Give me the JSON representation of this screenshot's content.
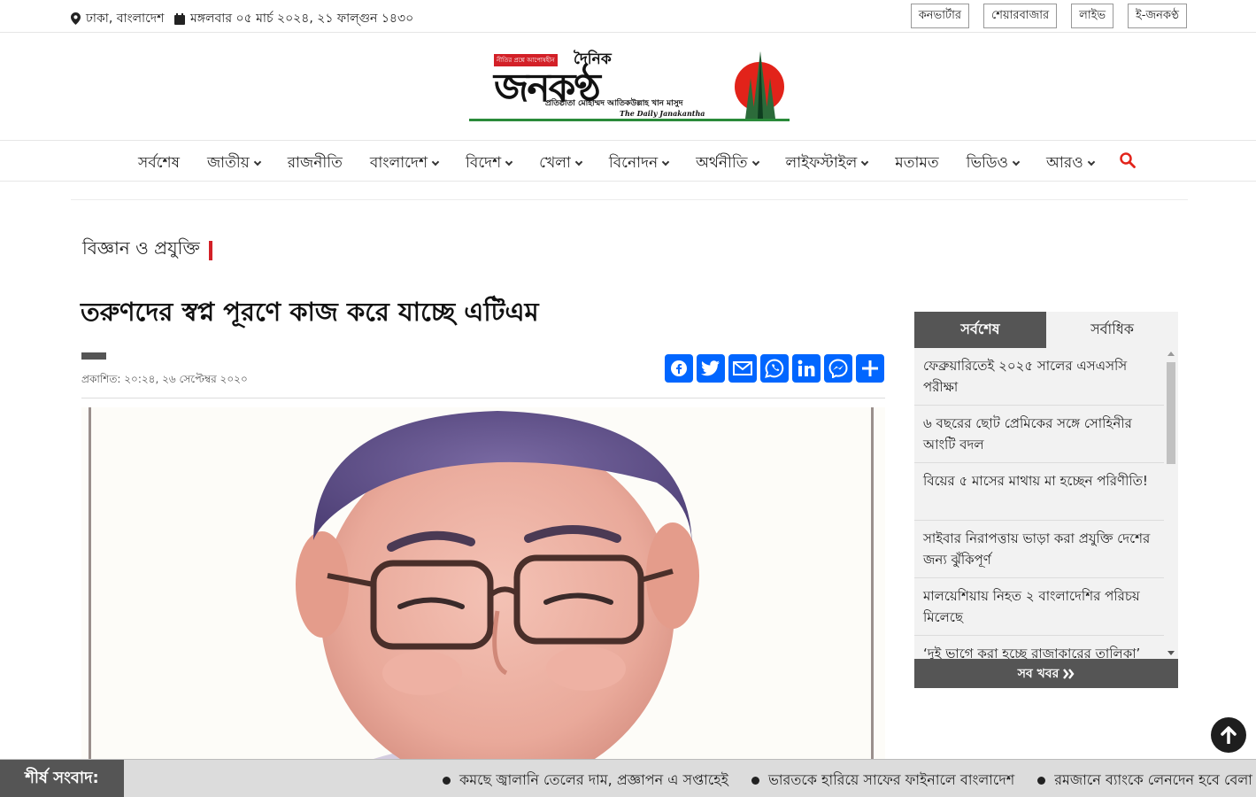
{
  "topbar": {
    "location": "ঢাকা, বাংলাদেশ",
    "date": "মঙ্গলবার ০৫ মার্চ ২০২৪, ২১ ফাল্গুন ১৪৩০",
    "links": [
      "কনভার্টার",
      "শেয়ারবাজার",
      "লাইভ",
      "ই-জনকণ্ঠ"
    ]
  },
  "logo": {
    "tagline": "নীতির প্রশ্নে আপোষহীন",
    "dainik": "দৈনিক",
    "name": "জনকণ্ঠ",
    "founder": "প্রতিষ্ঠাতা মোহাম্মদ আতিকউল্লাহ খান মাসুদ",
    "english": "The Daily Janakantha"
  },
  "nav": {
    "items": [
      {
        "label": "সর্বশেষ",
        "dropdown": false
      },
      {
        "label": "জাতীয়",
        "dropdown": true
      },
      {
        "label": "রাজনীতি",
        "dropdown": false
      },
      {
        "label": "বাংলাদেশ",
        "dropdown": true
      },
      {
        "label": "বিদেশ",
        "dropdown": true
      },
      {
        "label": "খেলা",
        "dropdown": true
      },
      {
        "label": "বিনোদন",
        "dropdown": true
      },
      {
        "label": "অর্থনীতি",
        "dropdown": true
      },
      {
        "label": "লাইফস্টাইল",
        "dropdown": true
      },
      {
        "label": "মতামত",
        "dropdown": false
      },
      {
        "label": "ভিডিও",
        "dropdown": true
      },
      {
        "label": "আরও",
        "dropdown": true
      }
    ],
    "search_icon": "search-icon"
  },
  "article": {
    "category": "বিজ্ঞান ও প্রযুক্তি",
    "headline": "তরুণদের স্বপ্ন পূরণে কাজ করে যাচ্ছে এটিএম",
    "published": "প্রকাশিত: ২০:২৪, ২৬ সেপ্টেম্বর ২০২০",
    "share": [
      "facebook",
      "twitter",
      "email",
      "whatsapp",
      "linkedin",
      "messenger",
      "share"
    ]
  },
  "sidebar": {
    "tabs": [
      "সর্বশেষ",
      "সর্বাধিক"
    ],
    "active_tab": 0,
    "news": [
      "ফেব্রুয়ারিতেই ২০২৫ সালের এসএসসি পরীক্ষা",
      "৬ বছরের ছোট প্রেমিকের সঙ্গে সোহিনীর আংটি বদল",
      "বিয়ের ৫ মাসের মাথায় মা হচ্ছেন পরিণীতি!",
      "সাইবার নিরাপত্তায় ভাড়া করা প্রযুক্তি দেশের জন্য ঝুঁকিপূর্ণ",
      "মালয়েশিয়ায় নিহত ২ বাংলাদেশির পরিচয় মিলেছে",
      "‘দুই ভাগে করা হচ্ছে রাজাকারের তালিকা’"
    ],
    "all_news": "সব খবর"
  },
  "ticker": {
    "label": "শীর্ষ সংবাদ:",
    "items": [
      "কমছে জ্বালানি তেলের দাম, প্রজ্ঞাপন এ সপ্তাহেই",
      "ভারতকে হারিয়ে সাফের ফাইনালে বাংলাদেশ",
      "রমজানে ব্যাংকে লেনদেন হবে বেলা আ"
    ]
  },
  "colors": {
    "accent_red": "#d32027",
    "dark_grey": "#555555",
    "share_blue": "#0166ff"
  }
}
